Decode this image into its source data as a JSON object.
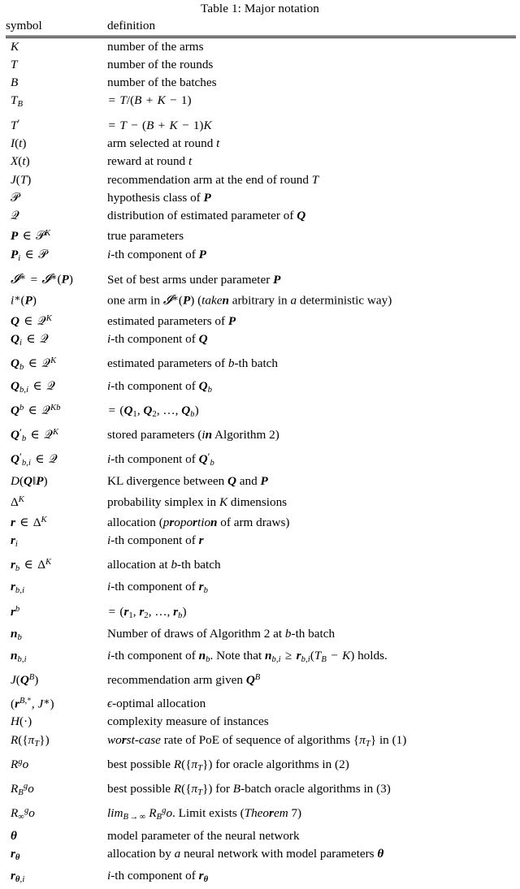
{
  "caption": "Table 1: Major notation",
  "columns": {
    "symbol": "symbol",
    "definition": "definition"
  },
  "rows": [
    {
      "symbol_text": "K",
      "definition_text": "number of the arms"
    },
    {
      "symbol_text": "T",
      "definition_text": "number of the rounds"
    },
    {
      "symbol_text": "B",
      "definition_text": "number of the batches"
    },
    {
      "symbol_text": "T_B",
      "definition_text": "= T/(B + K − 1)"
    },
    {
      "symbol_text": "T'",
      "definition_text": "= T − (B + K − 1)K"
    },
    {
      "symbol_text": "I(t)",
      "definition_text": "arm selected at round t"
    },
    {
      "symbol_text": "X(t)",
      "definition_text": "reward at round t"
    },
    {
      "symbol_text": "J(T)",
      "definition_text": "recommendation arm at the end of round T"
    },
    {
      "symbol_text": "𝒫",
      "definition_text": "hypothesis class of P"
    },
    {
      "symbol_text": "𝒬",
      "definition_text": "distribution of estimated parameter of Q"
    },
    {
      "symbol_text": "P ∈ 𝒫^K",
      "definition_text": "true parameters"
    },
    {
      "symbol_text": "P_i ∈ 𝒫",
      "definition_text": "i-th component of P"
    },
    {
      "symbol_text": "ℐ* = ℐ*(P)",
      "definition_text": "Set of best arms under parameter P"
    },
    {
      "symbol_text": "i*(P)",
      "definition_text": "one arm in ℐ*(P) (taken arbitrary in a deterministic way)"
    },
    {
      "symbol_text": "Q ∈ 𝒬^K",
      "definition_text": "estimated parameters of P"
    },
    {
      "symbol_text": "Q_i ∈ 𝒬",
      "definition_text": "i-th component of Q"
    },
    {
      "symbol_text": "Q_b ∈ 𝒬^K",
      "definition_text": "estimated parameters of b-th batch"
    },
    {
      "symbol_text": "Q_{b,i} ∈ 𝒬",
      "definition_text": "i-th component of Q_b"
    },
    {
      "symbol_text": "Q^b ∈ 𝒬^{Kb}",
      "definition_text": "= (Q_1, Q_2, …, Q_b)"
    },
    {
      "symbol_text": "Q'_b ∈ 𝒬^K",
      "definition_text": "stored parameters (in Algorithm 2)"
    },
    {
      "symbol_text": "Q'_{b,i} ∈ 𝒬",
      "definition_text": "i-th component of Q'_b"
    },
    {
      "symbol_text": "D(Q‖P)",
      "definition_text": "KL divergence between Q and P"
    },
    {
      "symbol_text": "Δ^K",
      "definition_text": "probability simplex in K dimensions"
    },
    {
      "symbol_text": "r ∈ Δ^K",
      "definition_text": "allocation (proportion of arm draws)"
    },
    {
      "symbol_text": "r_i",
      "definition_text": "i-th component of r"
    },
    {
      "symbol_text": "r_b ∈ Δ^K",
      "definition_text": "allocation at b-th batch"
    },
    {
      "symbol_text": "r_{b,i}",
      "definition_text": "i-th component of r_b"
    },
    {
      "symbol_text": "r^b",
      "definition_text": "= (r_1, r_2, …, r_b)"
    },
    {
      "symbol_text": "n_b",
      "definition_text": "Number of draws of Algorithm 2 at b-th batch"
    },
    {
      "symbol_text": "n_{b,i}",
      "definition_text": "i-th component of n_b. Note that n_{b,i} ≥ r_{b,i}(T_B − K) holds."
    },
    {
      "symbol_text": "J(Q^B)",
      "definition_text": "recommendation arm given Q^B"
    },
    {
      "symbol_text": "(r^{B,*}, J*)",
      "definition_text": "ϵ-optimal allocation"
    },
    {
      "symbol_text": "H(·)",
      "definition_text": "complexity measure of instances"
    },
    {
      "symbol_text": "R({π_T})",
      "definition_text": "worst-case rate of PoE of sequence of algorithms {π_T} in (1)"
    },
    {
      "symbol_text": "R^go",
      "definition_text": "best possible R({π_T}) for oracle algorithms in (2)"
    },
    {
      "symbol_text": "R_B^go",
      "definition_text": "best possible R({π_T}) for B-batch oracle algorithms in (3)"
    },
    {
      "symbol_text": "R_∞^go",
      "definition_text": "lim_{B→∞} R_B^go. Limit exists (Theorem 7)"
    },
    {
      "symbol_text": "θ",
      "definition_text": "model parameter of the neural network"
    },
    {
      "symbol_text": "r_θ",
      "definition_text": "allocation by a neural network with model parameters θ"
    },
    {
      "symbol_text": "r_{θ,i}",
      "definition_text": "i-th component of r_θ"
    }
  ]
}
